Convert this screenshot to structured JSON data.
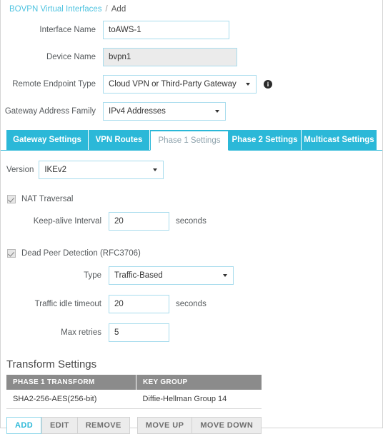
{
  "breadcrumb": {
    "root": "BOVPN Virtual Interfaces",
    "separator": "/",
    "current": "Add"
  },
  "form": {
    "interface_name": {
      "label": "Interface Name",
      "value": "toAWS-1"
    },
    "device_name": {
      "label": "Device Name",
      "value": "bvpn1"
    },
    "remote_endpoint_type": {
      "label": "Remote Endpoint Type",
      "value": "Cloud VPN or Third-Party Gateway",
      "info_icon": "info-icon",
      "caret_icon": "chevron-down-icon"
    },
    "gateway_address_family": {
      "label": "Gateway Address Family",
      "value": "IPv4 Addresses",
      "caret_icon": "chevron-down-icon"
    }
  },
  "tabs": [
    {
      "label": "Gateway Settings",
      "active": false
    },
    {
      "label": "VPN Routes",
      "active": false
    },
    {
      "label": "Phase 1 Settings",
      "active": true
    },
    {
      "label": "Phase 2 Settings",
      "active": false
    },
    {
      "label": "Multicast Settings",
      "active": false
    }
  ],
  "phase1": {
    "version": {
      "label": "Version",
      "value": "IKEv2",
      "caret_icon": "chevron-down-icon"
    },
    "nat_traversal": {
      "label": "NAT Traversal",
      "checked": true
    },
    "keep_alive_interval": {
      "label": "Keep-alive Interval",
      "value": "20",
      "unit": "seconds"
    },
    "dead_peer_detection": {
      "label": "Dead Peer Detection (RFC3706)",
      "checked": true
    },
    "dpd_type": {
      "label": "Type",
      "value": "Traffic-Based",
      "caret_icon": "chevron-down-icon"
    },
    "traffic_idle_timeout": {
      "label": "Traffic idle timeout",
      "value": "20",
      "unit": "seconds"
    },
    "max_retries": {
      "label": "Max retries",
      "value": "5"
    }
  },
  "transform_settings": {
    "title": "Transform Settings",
    "columns": [
      "PHASE 1 TRANSFORM",
      "KEY GROUP"
    ],
    "rows": [
      {
        "transform": "SHA2-256-AES(256-bit)",
        "key_group": "Diffie-Hellman Group 14"
      }
    ]
  },
  "buttons": {
    "add": "ADD",
    "edit": "EDIT",
    "remove": "REMOVE",
    "move_up": "MOVE UP",
    "move_down": "MOVE DOWN"
  },
  "colors": {
    "accent_teal": "#2bb8d8",
    "input_border": "#a8dced",
    "table_header_gray": "#8b8b8b",
    "link_teal": "#4ec3e0"
  }
}
